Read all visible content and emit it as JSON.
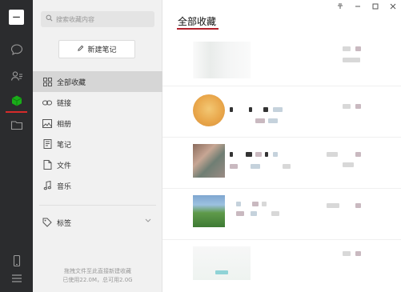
{
  "rail": {
    "avatar_glyph": "一",
    "icons": [
      "chat-icon",
      "contacts-icon",
      "favorites-icon",
      "folder-icon",
      "phone-icon",
      "menu-icon"
    ],
    "accent": "#d62b2b",
    "favorites_color": "#1aad19"
  },
  "sidebar": {
    "search_placeholder": "搜索收藏内容",
    "new_note_label": "新建笔记",
    "items": [
      {
        "label": "全部收藏",
        "icon": "grid-icon",
        "active": true
      },
      {
        "label": "链接",
        "icon": "link-icon",
        "active": false
      },
      {
        "label": "相册",
        "icon": "image-icon",
        "active": false
      },
      {
        "label": "笔记",
        "icon": "note-icon",
        "active": false
      },
      {
        "label": "文件",
        "icon": "file-icon",
        "active": false
      },
      {
        "label": "音乐",
        "icon": "music-icon",
        "active": false
      }
    ],
    "tags_label": "标签",
    "storage_line1": "拖拽文件至此直接新建收藏",
    "storage_line2": "已使用22.0M，总可用2.0G"
  },
  "main": {
    "title": "全部收藏",
    "window_controls": [
      "pin-icon",
      "minimize-icon",
      "maximize-icon",
      "close-icon"
    ],
    "title_underline_color": "#b2212b"
  }
}
